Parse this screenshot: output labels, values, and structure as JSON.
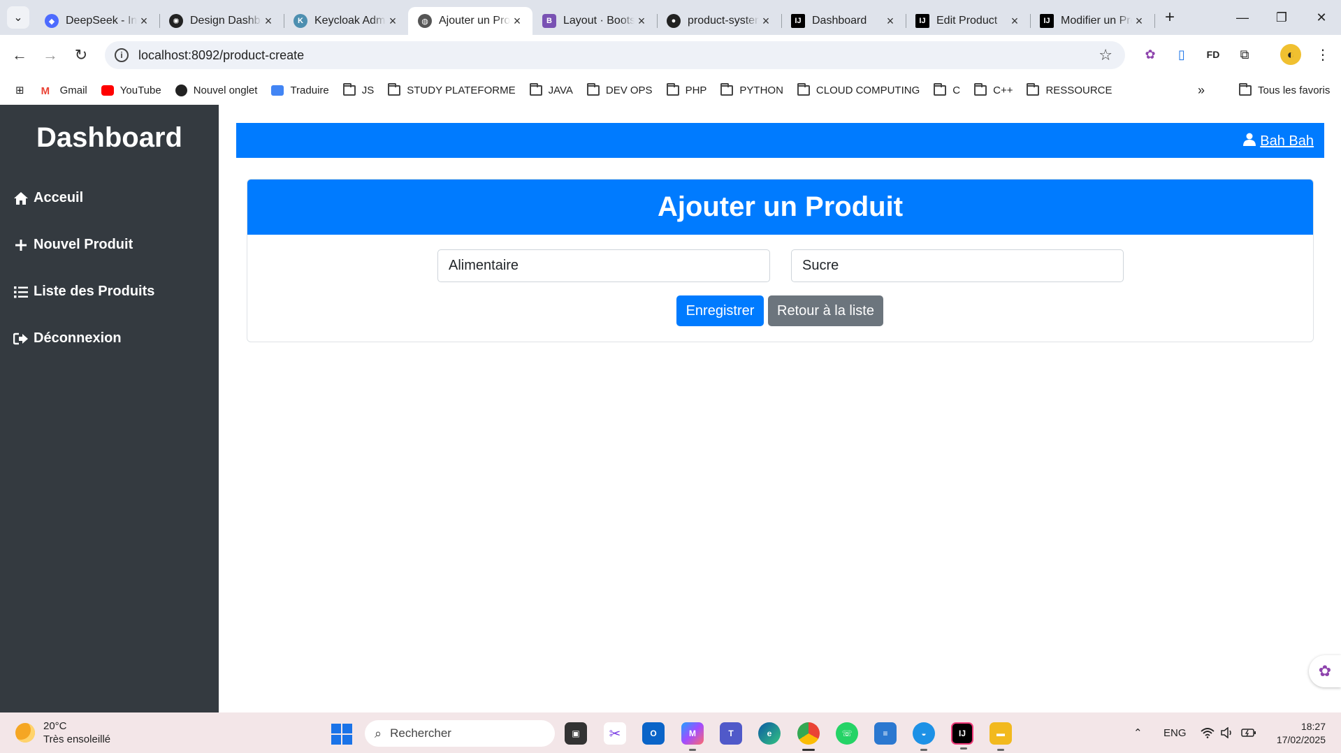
{
  "browser": {
    "tabs": [
      {
        "title": "DeepSeek - Into the Unknown",
        "icon": "deepseek-icon",
        "color": "#4d6bfe"
      },
      {
        "title": "Design Dashboard",
        "icon": "chatgpt-icon",
        "color": "#222222"
      },
      {
        "title": "Keycloak Administration",
        "icon": "keycloak-icon",
        "color": "#4d8fb0"
      },
      {
        "title": "Ajouter un Produit",
        "icon": "globe-icon",
        "color": "#555555"
      },
      {
        "title": "Layout · Bootstrap",
        "icon": "bootstrap-icon",
        "color": "#7952b3"
      },
      {
        "title": "product-system",
        "icon": "github-icon",
        "color": "#222222"
      },
      {
        "title": "Dashboard",
        "icon": "intellij-icon",
        "color": "#000000"
      },
      {
        "title": "Edit Product",
        "icon": "intellij-icon",
        "color": "#000000"
      },
      {
        "title": "Modifier un Produit",
        "icon": "intellij-icon",
        "color": "#000000"
      }
    ],
    "active_tab_index": 3,
    "url": "localhost:8092/product-create",
    "bookmarks": [
      {
        "label": "Gmail",
        "icon": "gmail-icon"
      },
      {
        "label": "YouTube",
        "icon": "youtube-icon"
      },
      {
        "label": "Nouvel onglet",
        "icon": "chatgpt-icon"
      },
      {
        "label": "Traduire",
        "icon": "translate-icon"
      },
      {
        "label": "JS",
        "icon": "folder-icon"
      },
      {
        "label": "STUDY PLATEFORME",
        "icon": "folder-icon"
      },
      {
        "label": "JAVA",
        "icon": "folder-icon"
      },
      {
        "label": "DEV OPS",
        "icon": "folder-icon"
      },
      {
        "label": "PHP",
        "icon": "folder-icon"
      },
      {
        "label": "PYTHON",
        "icon": "folder-icon"
      },
      {
        "label": "CLOUD COMPUTING",
        "icon": "folder-icon"
      },
      {
        "label": "C",
        "icon": "folder-icon"
      },
      {
        "label": "C++",
        "icon": "folder-icon"
      },
      {
        "label": "RESSOURCE",
        "icon": "folder-icon"
      }
    ],
    "all_bookmarks_label": "Tous les favoris"
  },
  "sidebar": {
    "brand": "Dashboard",
    "items": [
      {
        "label": "Acceuil",
        "icon": "home-icon"
      },
      {
        "label": "Nouvel Produit",
        "icon": "plus-icon"
      },
      {
        "label": "Liste des Produits",
        "icon": "list-icon"
      },
      {
        "label": "Déconnexion",
        "icon": "logout-icon"
      }
    ]
  },
  "topbar": {
    "user_name": "Bah Bah"
  },
  "form": {
    "title": "Ajouter un Produit",
    "category_value": "Alimentaire",
    "name_value": "Sucre",
    "save_label": "Enregistrer",
    "back_label": "Retour à la liste"
  },
  "colors": {
    "primary": "#007bff",
    "secondary": "#6c757d",
    "sidebar_bg": "#343a40"
  },
  "taskbar": {
    "weather_temp": "20°C",
    "weather_desc": "Très ensoleillé",
    "search_placeholder": "Rechercher",
    "language": "ENG",
    "time": "18:27",
    "date": "17/02/2025"
  }
}
